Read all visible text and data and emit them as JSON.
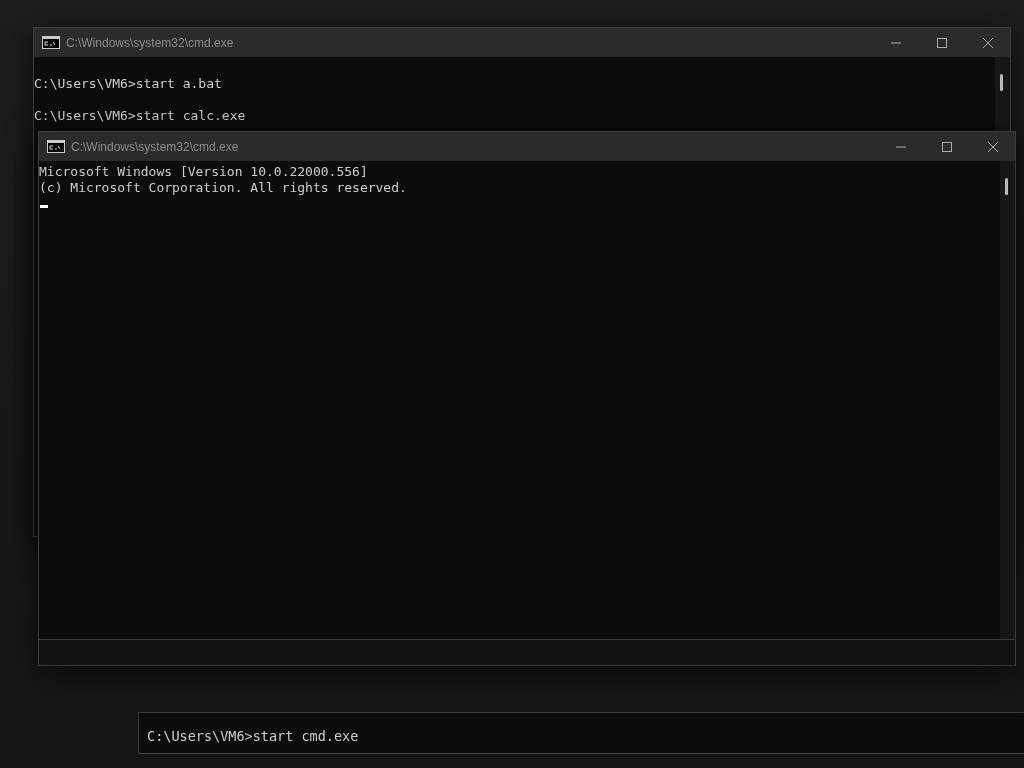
{
  "background_console": {
    "lines": [
      "C:\\Users\\VM6>start cmd.exe"
    ]
  },
  "windows": [
    {
      "title": "C:\\Windows\\system32\\cmd.exe",
      "lines": [
        {
          "kind": "blank"
        },
        {
          "kind": "text",
          "text": "C:\\Users\\VM6>start a.bat"
        },
        {
          "kind": "blank"
        },
        {
          "kind": "text",
          "text": "C:\\Users\\VM6>start calc.exe"
        }
      ],
      "cursor": false
    },
    {
      "title": "C:\\Windows\\system32\\cmd.exe",
      "lines": [
        {
          "kind": "text",
          "text": "Microsoft Windows [Version 10.0.22000.556]"
        },
        {
          "kind": "text",
          "text": "(c) Microsoft Corporation. All rights reserved."
        },
        {
          "kind": "blank"
        }
      ],
      "cursor": true
    }
  ]
}
